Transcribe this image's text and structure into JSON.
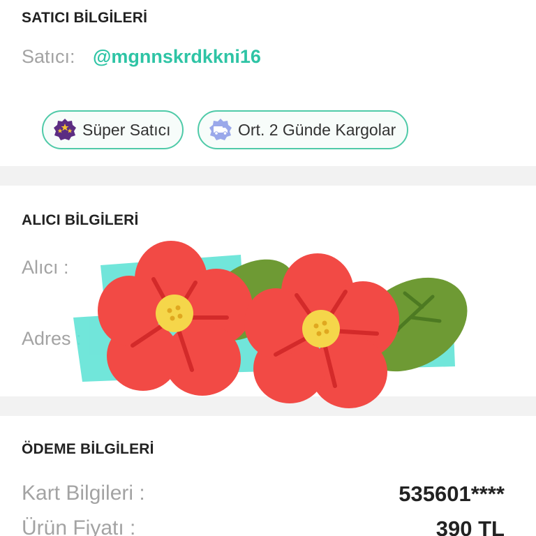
{
  "seller_section": {
    "title": "SATICI BİLGİLERİ",
    "seller_label": "Satıcı:",
    "seller_name": "@mgnnskrdkkni16",
    "badges": [
      {
        "label": "Süper Satıcı",
        "icon": "star-badge-icon"
      },
      {
        "label": "Ort. 2 Günde Kargolar",
        "icon": "truck-badge-icon"
      }
    ]
  },
  "buyer_section": {
    "title": "ALICI BİLGİLERİ",
    "buyer_label": "Alıcı :",
    "address_label": "Adres :"
  },
  "payment_section": {
    "title": "ÖDEME BİLGİLERİ",
    "card_label": "Kart Bilgileri :",
    "card_value": "535601****",
    "price_label": "Ürün Fiyatı :",
    "price_value": "390 TL"
  },
  "colors": {
    "accent": "#2ec4a5",
    "chip_border": "#4fcaa8",
    "section_gap": "#f2f2f2",
    "label_gray": "#a3a3a3",
    "flower_red": "#f24a45",
    "leaf_green": "#6e9a34",
    "redaction_teal": "#62e3d6"
  }
}
